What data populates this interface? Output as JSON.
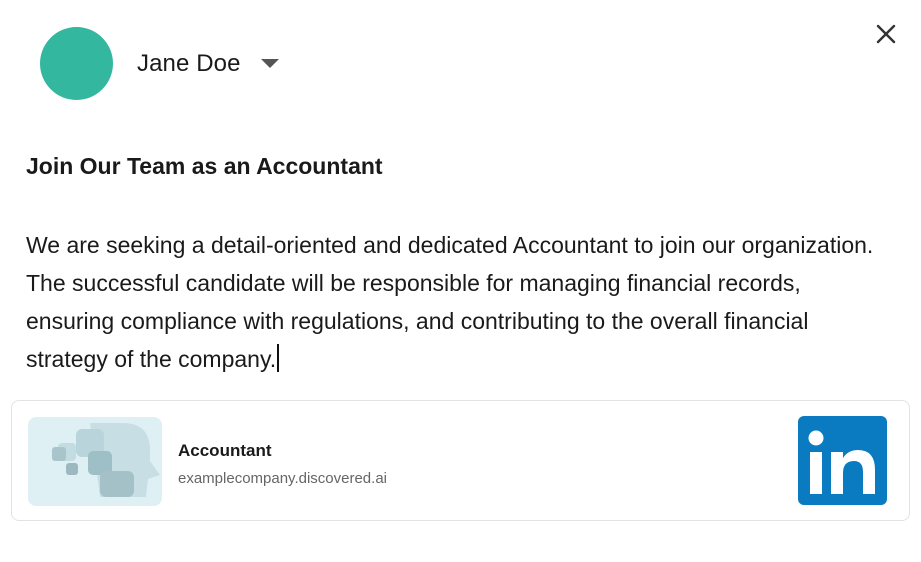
{
  "author": {
    "name": "Jane Doe",
    "avatar_color": "#33b79e"
  },
  "icons": {
    "close": "close-icon",
    "dropdown": "chevron-down-icon"
  },
  "post": {
    "title": "Join Our Team as an Accountant",
    "body": "We are seeking a detail-oriented and dedicated Accountant to join our organization. The successful candidate will be responsible for managing financial records, ensuring compliance with regulations, and contributing to the overall financial strategy of the company."
  },
  "link_preview": {
    "title": "Accountant",
    "url": "examplecompany.discovered.ai",
    "logo_text": "in",
    "logo_color": "#0a7bc1",
    "thumbnail_color": "#dff0f4"
  }
}
